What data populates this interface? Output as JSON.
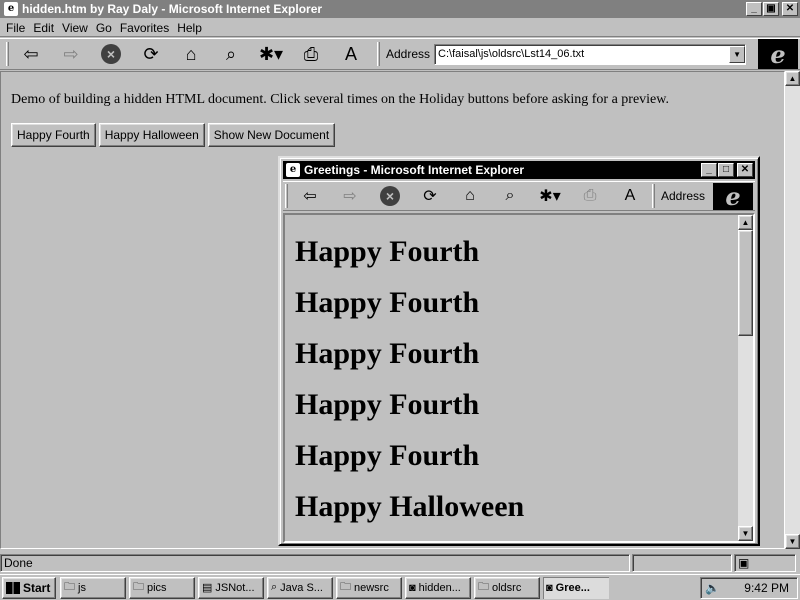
{
  "main_window": {
    "title": "hidden.htm by Ray Daly - Microsoft Internet Explorer",
    "window_buttons": {
      "minimize": "_",
      "restore": "▣",
      "close": "✕"
    },
    "menu": [
      "File",
      "Edit",
      "View",
      "Go",
      "Favorites",
      "Help"
    ],
    "toolbar": {
      "icons": [
        "back-icon",
        "forward-icon",
        "stop-icon",
        "refresh-icon",
        "home-icon",
        "search-icon",
        "favorites-icon",
        "print-icon",
        "font-icon"
      ],
      "address_label": "Address",
      "address_value": "C:\\faisal\\js\\oldsrc\\Lst14_06.txt"
    }
  },
  "page": {
    "text": "Demo of building a hidden HTML document. Click several times on the Holiday buttons before asking for a preview.",
    "buttons": [
      "Happy Fourth",
      "Happy Halloween",
      "Show New Document"
    ]
  },
  "popup": {
    "title": "Greetings - Microsoft Internet Explorer",
    "address_label": "Address",
    "greetings": [
      "Happy Fourth",
      "Happy Fourth",
      "Happy Fourth",
      "Happy Fourth",
      "Happy Fourth",
      "Happy Halloween"
    ]
  },
  "status": {
    "text": "Done"
  },
  "taskbar": {
    "start_label": "Start",
    "tasks": [
      {
        "label": "js",
        "icon": "folder-icon",
        "active": false
      },
      {
        "label": "pics",
        "icon": "folder-icon",
        "active": false
      },
      {
        "label": "JSNot...",
        "icon": "document-icon",
        "active": false
      },
      {
        "label": "Java S...",
        "icon": "search-icon",
        "active": false
      },
      {
        "label": "newsrc",
        "icon": "folder-icon",
        "active": false
      },
      {
        "label": "hidden...",
        "icon": "browser-icon",
        "active": false
      },
      {
        "label": "oldsrc",
        "icon": "folder-icon",
        "active": false
      },
      {
        "label": "Gree...",
        "icon": "browser-icon",
        "active": true
      }
    ],
    "clock": "9:42 PM"
  },
  "colors": {
    "desktop_gray": "#c0c0c0",
    "title_active": "#000000",
    "title_inactive": "#808080"
  }
}
